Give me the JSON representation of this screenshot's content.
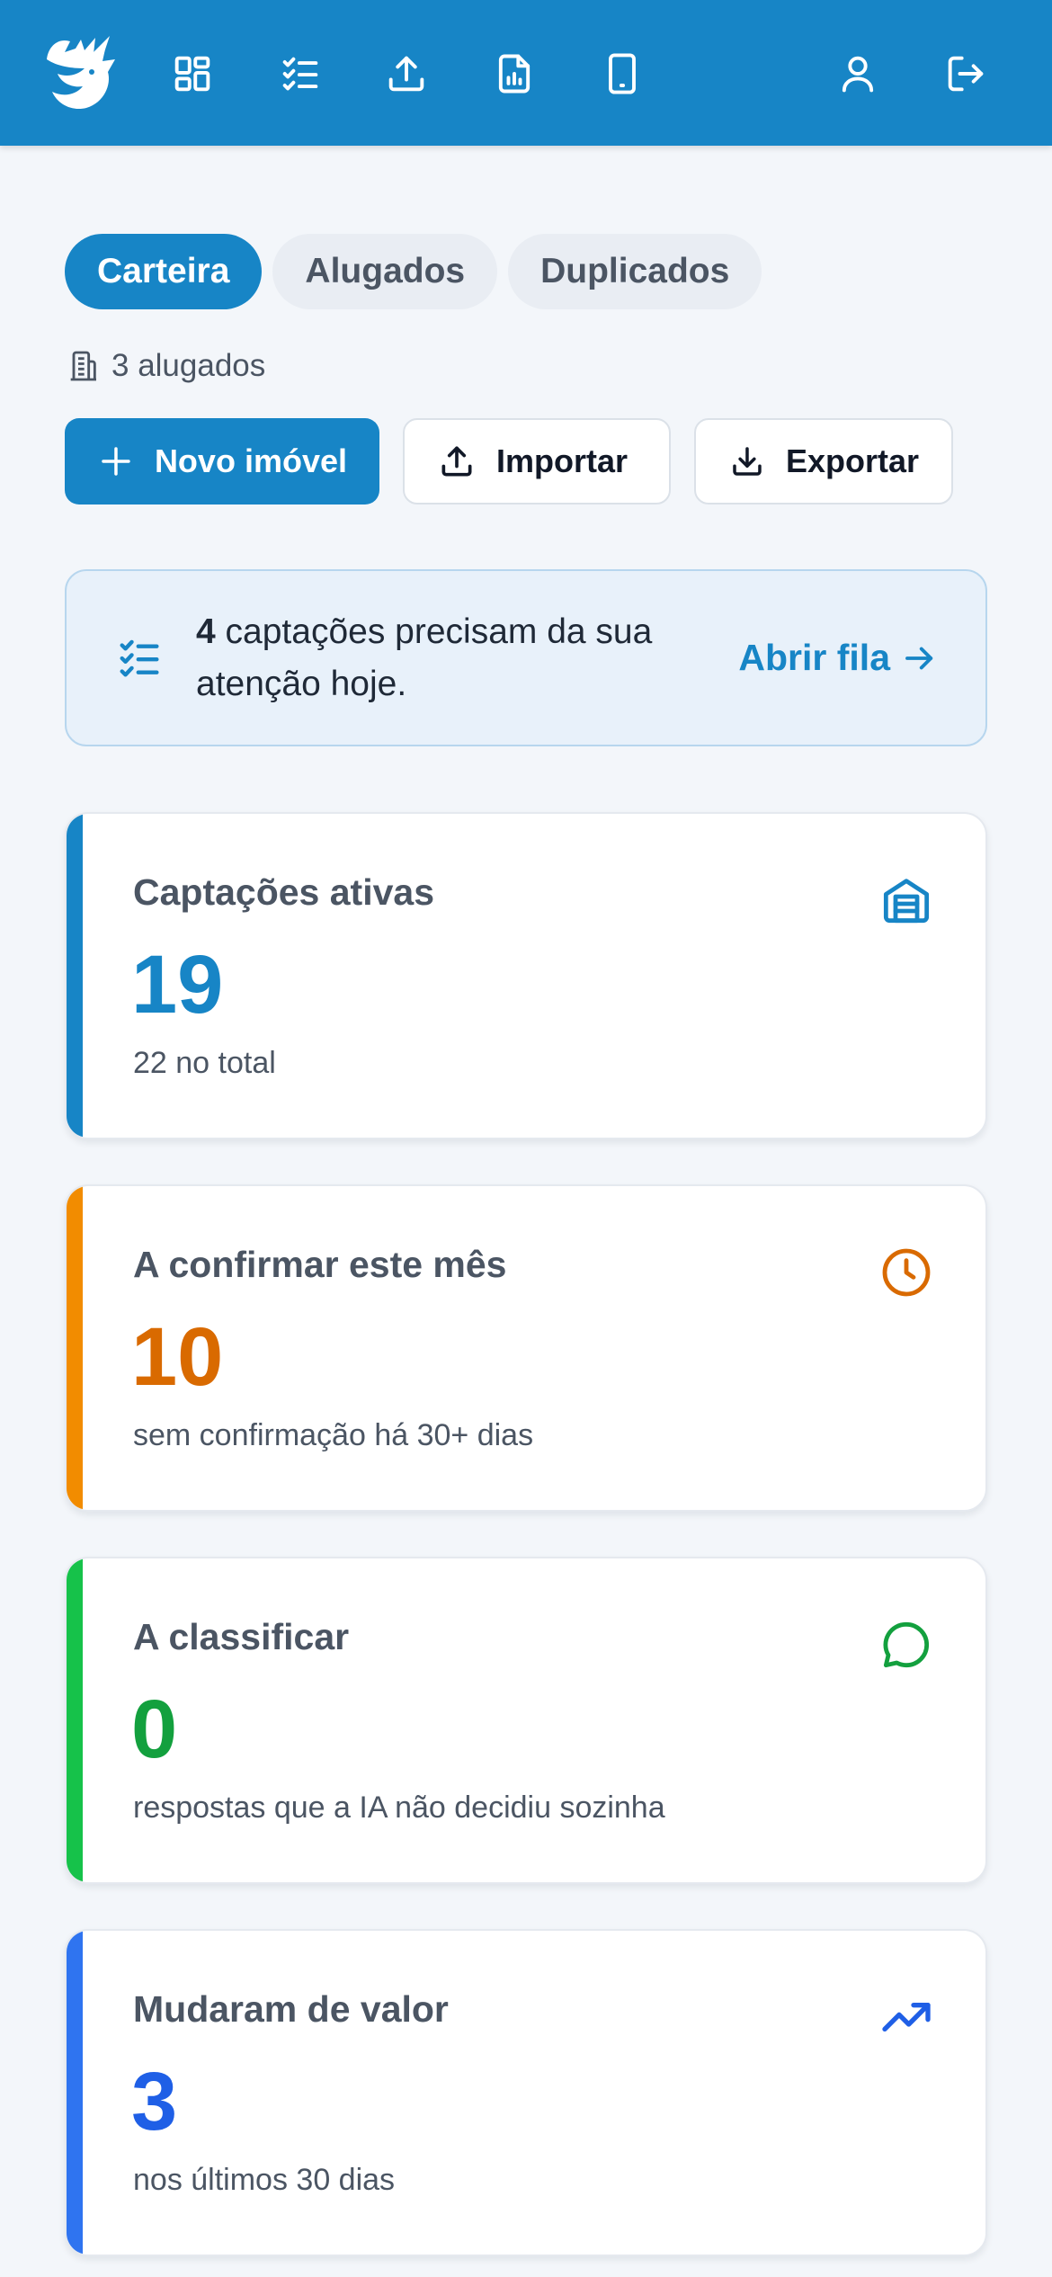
{
  "header": {
    "logo": "unicorn-logo",
    "nav_icons": [
      "grid-icon",
      "checklist-icon",
      "upload-icon",
      "report-icon",
      "mobile-icon"
    ],
    "right_icons": [
      "user-icon",
      "logout-icon"
    ]
  },
  "tabs": [
    {
      "label": "Carteira",
      "active": true
    },
    {
      "label": "Alugados",
      "active": false
    },
    {
      "label": "Duplicados",
      "active": false
    }
  ],
  "summary": {
    "count_text": "3 alugados"
  },
  "actions": {
    "new_label": "Novo imóvel",
    "import_label": "Importar",
    "export_label": "Exportar"
  },
  "alert": {
    "count": "4",
    "text": " captações precisam da sua atenção hoje.",
    "link": "Abrir fila"
  },
  "cards": [
    {
      "title": "Captações ativas",
      "value": "19",
      "sub": "22 no total",
      "color": "#1785c6",
      "icon": "building-icon"
    },
    {
      "title": "A confirmar este mês",
      "value": "10",
      "sub": "sem confirmação há 30+ dias",
      "color": "#f28c00",
      "value_color": "#d96a00",
      "icon": "clock-icon"
    },
    {
      "title": "A classificar",
      "value": "0",
      "sub": "respostas que a IA não decidiu sozinha",
      "color": "#16c24a",
      "value_color": "#13a03e",
      "icon": "chat-icon"
    },
    {
      "title": "Mudaram de valor",
      "value": "3",
      "sub": "nos últimos 30 dias",
      "color": "#2f74f0",
      "value_color": "#1f5fe6",
      "icon": "trending-up-icon"
    }
  ]
}
